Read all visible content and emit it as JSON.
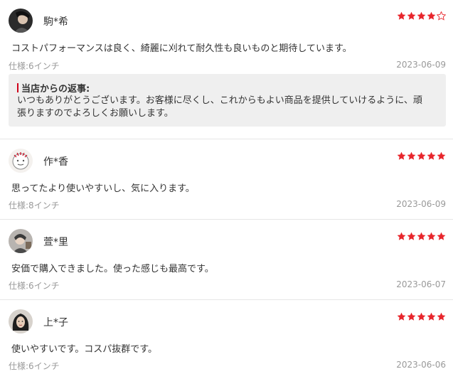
{
  "colors": {
    "star_filled": "#e8262c",
    "star_empty": "#e8262c",
    "reply_accent": "#d0021b",
    "reply_bg": "#efefef"
  },
  "reviews": [
    {
      "user": "駒*希",
      "rating": 4,
      "comment": "コストパフォーマンスは良く、綺麗に刈れて耐久性も良いものと期待しています。",
      "spec": "仕様:6インチ",
      "date": "2023-06-09",
      "reply": {
        "title": "当店からの返事:",
        "text": "いつもありがとうございます。お客様に尽くし、これからもよい商品を提供していけるように、頑張りますのでよろしくお願いします。"
      }
    },
    {
      "user": "作*香",
      "rating": 5,
      "comment": "思ってたより使いやすいし、気に入ります。",
      "spec": "仕様:8インチ",
      "date": "2023-06-09"
    },
    {
      "user": "萱*里",
      "rating": 5,
      "comment": "安価で購入できました。使った感じも最高です。",
      "spec": "仕様:6インチ",
      "date": "2023-06-07"
    },
    {
      "user": "上*子",
      "rating": 5,
      "comment": "使いやすいです。コスパ抜群です。",
      "spec": "仕様:6インチ",
      "date": "2023-06-06"
    }
  ]
}
